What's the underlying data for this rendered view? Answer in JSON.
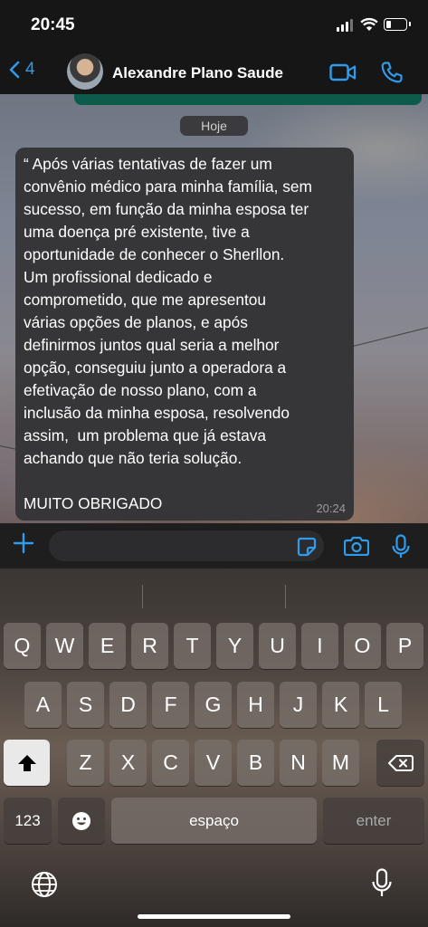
{
  "status_bar": {
    "time": "20:45"
  },
  "header": {
    "back_count": "4",
    "contact_name": "Alexandre Plano Saude"
  },
  "chat": {
    "date_label": "Hoje",
    "message": {
      "text": "“ Após várias tentativas de fazer um\nconvênio médico para minha família, sem\nsucesso, em função da minha esposa ter\numa doença pré existente, tive a\noportunidade de conhecer o Sherllon.\nUm profissional dedicado e\ncomprometido, que me apresentou\nvárias opções de planos, e após\ndefinirmos juntos qual seria a melhor\nopção, conseguiu junto a operadora a\nefetivação de nosso plano, com a\ninclusão da minha esposa, resolvendo\nassim,  um problema que já estava\nachando que não teria solução.\n\nMUITO OBRIGADO",
      "time": "20:24"
    }
  },
  "input": {
    "value": "",
    "placeholder": ""
  },
  "keyboard": {
    "row1": [
      "Q",
      "W",
      "E",
      "R",
      "T",
      "Y",
      "U",
      "I",
      "O",
      "P"
    ],
    "row2": [
      "A",
      "S",
      "D",
      "F",
      "G",
      "H",
      "J",
      "K",
      "L"
    ],
    "row3": [
      "Z",
      "X",
      "C",
      "V",
      "B",
      "N",
      "M"
    ],
    "numbers_label": "123",
    "space_label": "espaço",
    "enter_label": "enter"
  },
  "icons": {
    "back": "chevron-left-icon",
    "video": "video-call-icon",
    "phone": "phone-icon",
    "plus": "plus-icon",
    "sticker": "sticker-icon",
    "camera": "camera-icon",
    "mic": "microphone-icon",
    "shift": "shift-icon",
    "delete": "backspace-icon",
    "emoji": "emoji-icon",
    "globe": "globe-icon"
  },
  "colors": {
    "accent": "#2f9bea",
    "bubble": "#363638",
    "header": "#161616"
  }
}
